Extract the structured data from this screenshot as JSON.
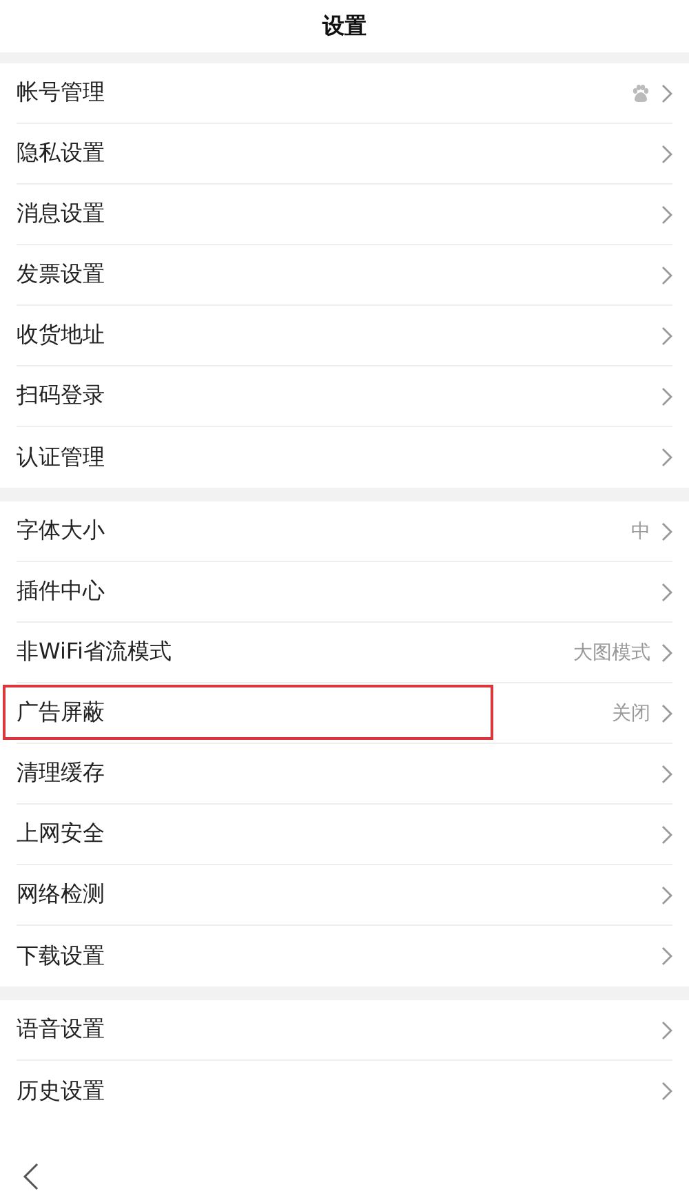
{
  "header": {
    "title": "设置"
  },
  "groups": [
    {
      "rows": [
        {
          "label": "帐号管理",
          "paw_icon": true,
          "highlighted": false
        },
        {
          "label": "隐私设置",
          "highlighted": false
        },
        {
          "label": "消息设置",
          "highlighted": false
        },
        {
          "label": "发票设置",
          "highlighted": false
        },
        {
          "label": "收货地址",
          "highlighted": false
        },
        {
          "label": "扫码登录",
          "highlighted": false
        },
        {
          "label": "认证管理",
          "highlighted": false
        }
      ]
    },
    {
      "rows": [
        {
          "label": "字体大小",
          "value": "中",
          "highlighted": false
        },
        {
          "label": "插件中心",
          "highlighted": false
        },
        {
          "label": "非WiFi省流模式",
          "value": "大图模式",
          "highlighted": false
        },
        {
          "label": "广告屏蔽",
          "value": "关闭",
          "highlighted": true
        },
        {
          "label": "清理缓存",
          "highlighted": false
        },
        {
          "label": "上网安全",
          "highlighted": false
        },
        {
          "label": "网络检测",
          "highlighted": false
        },
        {
          "label": "下载设置",
          "highlighted": false
        }
      ]
    },
    {
      "rows": [
        {
          "label": "语音设置",
          "highlighted": false
        },
        {
          "label": "历史设置",
          "highlighted": false
        }
      ]
    }
  ]
}
